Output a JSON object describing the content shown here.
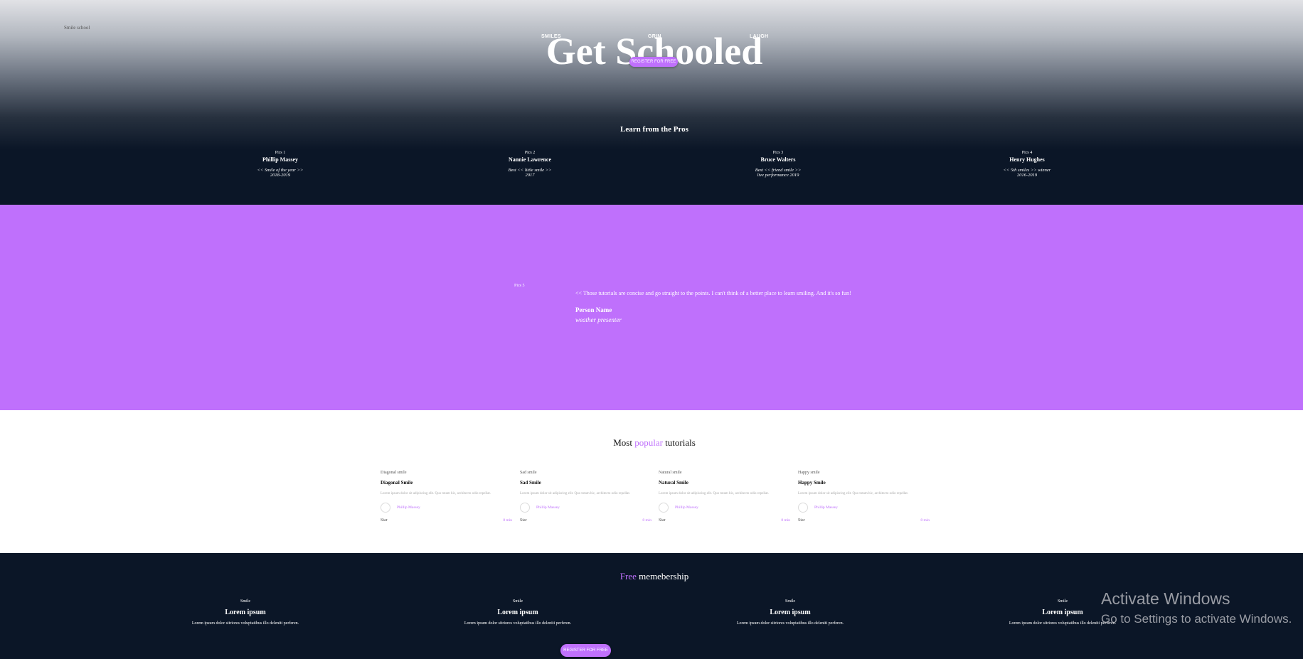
{
  "header": {
    "logo_alt": "Smile school",
    "nav": [
      "SMILES",
      "GRIN",
      "LAUGH"
    ],
    "title": "Get Schooled",
    "register_label": "REGISTER FOR FREE"
  },
  "pros": {
    "heading": "Learn from the Pros",
    "items": [
      {
        "pic": "Pics 1",
        "name": "Phillip Massey",
        "award_line1": "<< Smile of the year >>",
        "award_line2": "2018-2019"
      },
      {
        "pic": "Pics 2",
        "name": "Nannie Lawrence",
        "award_line1": "Best << little smile >>",
        "award_line2": "2017"
      },
      {
        "pic": "Pics 3",
        "name": "Bruce Walters",
        "award_line1": "Best << friend smile >>",
        "award_line2": "live performance 2019"
      },
      {
        "pic": "Pics 4",
        "name": "Henry Hughes",
        "award_line1": "<< 5th smiles >> winner",
        "award_line2": "2016-2019"
      }
    ]
  },
  "testimonial": {
    "pic_alt": "Pics 5",
    "quote": "<< Those tutorials are concise and go straight to the points. I can't think of a better place to learn smiling. And it's so fun!",
    "person_name": "Person Name",
    "person_title": "weather presenter"
  },
  "tutorials": {
    "heading_pre": "Most",
    "heading_accent": "popular",
    "heading_post": "tutorials",
    "items": [
      {
        "img_alt": "Diagonal smile",
        "title": "Diagonal Smile",
        "desc": "Lorem ipsum dolor sit adipiscing elit. Quo totam hic, architecto odio repellat.",
        "author": "Phillip Massey",
        "star_alt": "Star",
        "time": "8 min"
      },
      {
        "img_alt": "Sad smile",
        "title": "Sad Smile",
        "desc": "Lorem ipsum dolor sit adipiscing elit. Quo totam hic, architecto odio repellat.",
        "author": "Phillip Massey",
        "star_alt": "Star",
        "time": "8 min"
      },
      {
        "img_alt": "Natural smile",
        "title": "Natural Smile",
        "desc": "Lorem ipsum dolor sit adipiscing elit. Quo totam hic, architecto odio repellat.",
        "author": "Phillip Massey",
        "star_alt": "Star",
        "time": "8 min"
      },
      {
        "img_alt": "Happy smile",
        "title": "Happy Smile",
        "desc": "Lorem ipsum dolor sit adipiscing elit. Quo totam hic, architecto odio repellat.",
        "author": "Phillip Massey",
        "star_alt": "Star",
        "time": "8 min"
      }
    ]
  },
  "membership": {
    "heading_accent": "Free",
    "heading_post": "memebership",
    "items": [
      {
        "img_alt": "Smile",
        "title": "Lorem ipsum",
        "desc": "Lorem ipsum dolor sitriores voluptatibus illo deleniti perferen."
      },
      {
        "img_alt": "Smile",
        "title": "Lorem ipsum",
        "desc": "Lorem ipsum dolor sitriores voluptatibus illo deleniti perferen."
      },
      {
        "img_alt": "Smile",
        "title": "Lorem ipsum",
        "desc": "Lorem ipsum dolor sitriores voluptatibus illo deleniti perferen."
      },
      {
        "img_alt": "Smile",
        "title": "Lorem ipsum",
        "desc": "Lorem ipsum dolor sitriores voluptatibus illo deleniti perferen."
      }
    ],
    "register_label": "REGISTER FOR FREE"
  },
  "watermark": {
    "line1": "Activate Windows",
    "line2": "Go to Settings to activate Windows."
  },
  "colors": {
    "accent": "#bf70fc",
    "dark": "#0b1627"
  }
}
